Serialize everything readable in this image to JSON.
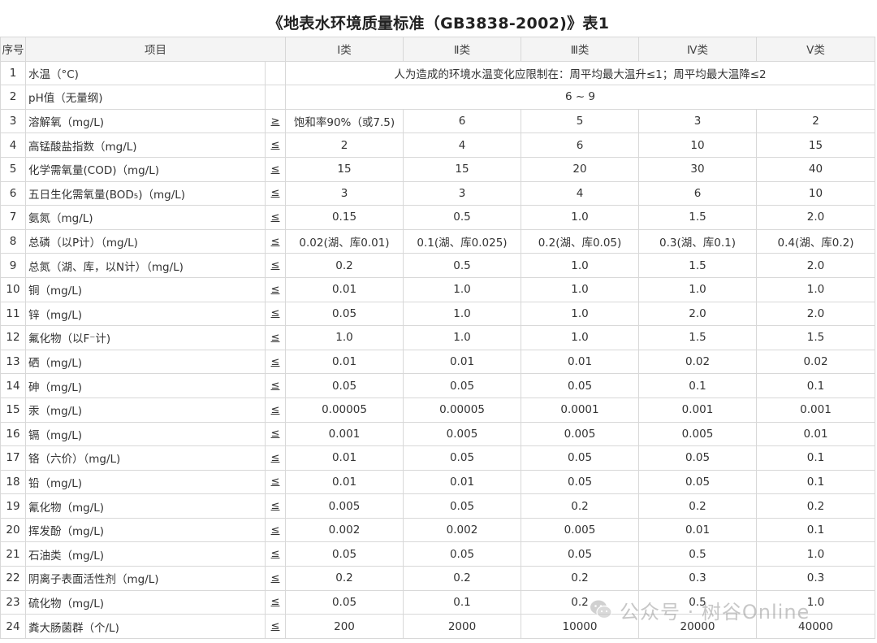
{
  "title": "《地表水环境质量标准（GB3838-2002)》表1",
  "table": {
    "headers": [
      "序号",
      "项目",
      "Ⅰ类",
      "Ⅱ类",
      "Ⅲ类",
      "Ⅳ类",
      "Ⅴ类"
    ],
    "rows": [
      {
        "no": "1",
        "item": "水温（°C)",
        "op": "",
        "span": "人为造成的环境水温变化应限制在：周平均最大温升≤1；周平均最大温降≤2"
      },
      {
        "no": "2",
        "item": "pH值（无量纲)",
        "op": "",
        "span": "6 ~ 9"
      },
      {
        "no": "3",
        "item": "溶解氧（mg/L)",
        "op": "≥",
        "values": [
          "饱和率90%（或7.5)",
          "6",
          "5",
          "3",
          "2"
        ]
      },
      {
        "no": "4",
        "item": "高锰酸盐指数（mg/L)",
        "op": "≤",
        "values": [
          "2",
          "4",
          "6",
          "10",
          "15"
        ]
      },
      {
        "no": "5",
        "item": "化学需氧量(COD)（mg/L)",
        "op": "≤",
        "values": [
          "15",
          "15",
          "20",
          "30",
          "40"
        ]
      },
      {
        "no": "6",
        "item": "五日生化需氧量(BOD₅)（mg/L)",
        "op": "≤",
        "values": [
          "3",
          "3",
          "4",
          "6",
          "10"
        ]
      },
      {
        "no": "7",
        "item": "氨氮（mg/L)",
        "op": "≤",
        "values": [
          "0.15",
          "0.5",
          "1.0",
          "1.5",
          "2.0"
        ]
      },
      {
        "no": "8",
        "item": "总磷（以P计）（mg/L)",
        "op": "≤",
        "values": [
          "0.02(湖、库0.01)",
          "0.1(湖、库0.025)",
          "0.2(湖、库0.05)",
          "0.3(湖、库0.1)",
          "0.4(湖、库0.2)"
        ]
      },
      {
        "no": "9",
        "item": "总氮（湖、库，以N计）（mg/L)",
        "op": "≤",
        "values": [
          "0.2",
          "0.5",
          "1.0",
          "1.5",
          "2.0"
        ]
      },
      {
        "no": "10",
        "item": "铜（mg/L)",
        "op": "≤",
        "values": [
          "0.01",
          "1.0",
          "1.0",
          "1.0",
          "1.0"
        ]
      },
      {
        "no": "11",
        "item": "锌（mg/L)",
        "op": "≤",
        "values": [
          "0.05",
          "1.0",
          "1.0",
          "2.0",
          "2.0"
        ]
      },
      {
        "no": "12",
        "item": "氟化物（以F⁻计)",
        "op": "≤",
        "values": [
          "1.0",
          "1.0",
          "1.0",
          "1.5",
          "1.5"
        ]
      },
      {
        "no": "13",
        "item": "硒（mg/L)",
        "op": "≤",
        "values": [
          "0.01",
          "0.01",
          "0.01",
          "0.02",
          "0.02"
        ]
      },
      {
        "no": "14",
        "item": "砷（mg/L)",
        "op": "≤",
        "values": [
          "0.05",
          "0.05",
          "0.05",
          "0.1",
          "0.1"
        ]
      },
      {
        "no": "15",
        "item": "汞（mg/L)",
        "op": "≤",
        "values": [
          "0.00005",
          "0.00005",
          "0.0001",
          "0.001",
          "0.001"
        ]
      },
      {
        "no": "16",
        "item": "镉（mg/L)",
        "op": "≤",
        "values": [
          "0.001",
          "0.005",
          "0.005",
          "0.005",
          "0.01"
        ]
      },
      {
        "no": "17",
        "item": "铬（六价）（mg/L)",
        "op": "≤",
        "values": [
          "0.01",
          "0.05",
          "0.05",
          "0.05",
          "0.1"
        ]
      },
      {
        "no": "18",
        "item": "铅（mg/L)",
        "op": "≤",
        "values": [
          "0.01",
          "0.01",
          "0.05",
          "0.05",
          "0.1"
        ]
      },
      {
        "no": "19",
        "item": "氰化物（mg/L)",
        "op": "≤",
        "values": [
          "0.005",
          "0.05",
          "0.2",
          "0.2",
          "0.2"
        ]
      },
      {
        "no": "20",
        "item": "挥发酚（mg/L)",
        "op": "≤",
        "values": [
          "0.002",
          "0.002",
          "0.005",
          "0.01",
          "0.1"
        ]
      },
      {
        "no": "21",
        "item": "石油类（mg/L)",
        "op": "≤",
        "values": [
          "0.05",
          "0.05",
          "0.05",
          "0.5",
          "1.0"
        ]
      },
      {
        "no": "22",
        "item": "阴离子表面活性剂（mg/L)",
        "op": "≤",
        "values": [
          "0.2",
          "0.2",
          "0.2",
          "0.3",
          "0.3"
        ]
      },
      {
        "no": "23",
        "item": "硫化物（mg/L)",
        "op": "≤",
        "values": [
          "0.05",
          "0.1",
          "0.2",
          "0.5",
          "1.0"
        ]
      },
      {
        "no": "24",
        "item": "粪大肠菌群（个/L)",
        "op": "≤",
        "values": [
          "200",
          "2000",
          "10000",
          "20000",
          "40000"
        ]
      }
    ]
  },
  "watermark": {
    "text": "公众号 · 树谷Online",
    "icon": "wechat-icon"
  }
}
